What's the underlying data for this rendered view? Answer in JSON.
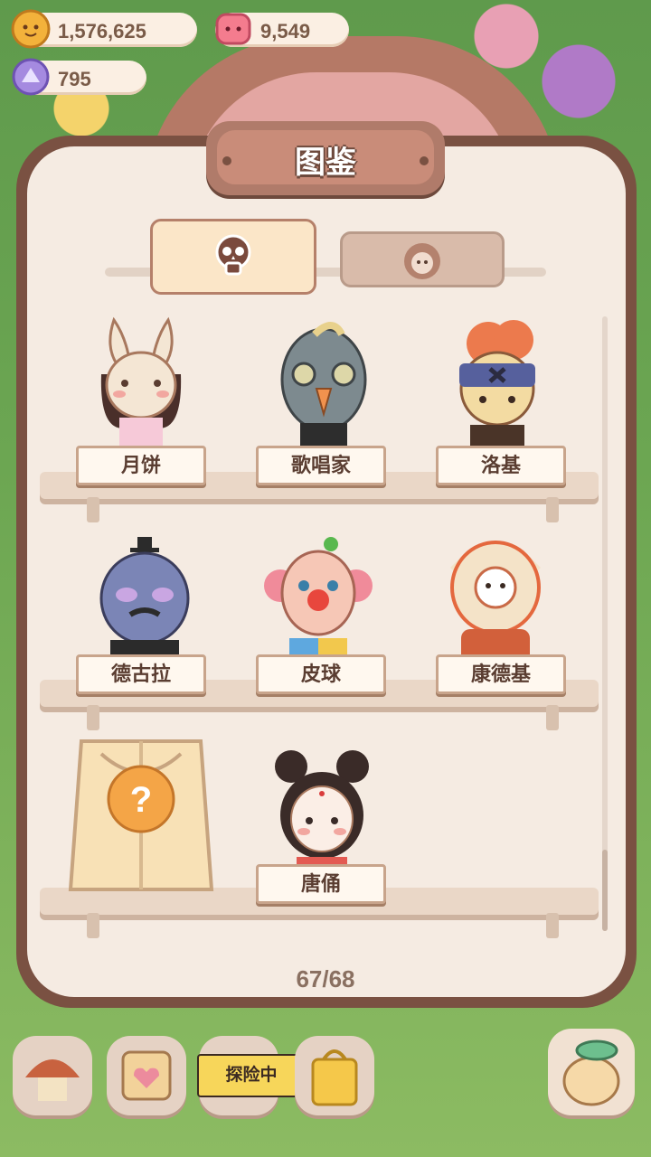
{
  "currencies": {
    "coins": "1,576,625",
    "gems": "9,549",
    "crystals": "795"
  },
  "panel": {
    "title": "图鉴",
    "counter": "67/68"
  },
  "tabs": [
    {
      "icon": "skull-icon",
      "active": true
    },
    {
      "icon": "character-face-icon",
      "active": false
    }
  ],
  "collection": [
    {
      "name": "月饼",
      "icon": "bunny-character-icon"
    },
    {
      "name": "歌唱家",
      "icon": "bird-character-icon"
    },
    {
      "name": "洛基",
      "icon": "pirate-character-icon"
    },
    {
      "name": "德古拉",
      "icon": "dracula-character-icon"
    },
    {
      "name": "皮球",
      "icon": "clown-character-icon"
    },
    {
      "name": "康德基",
      "icon": "chicken-character-icon"
    },
    {
      "name": "",
      "icon": "mystery-package-icon"
    },
    {
      "name": "唐俑",
      "icon": "tang-figurine-character-icon"
    }
  ],
  "bottom_bar": {
    "explore_label": "探险中"
  },
  "colors": {
    "panel_bg": "#f5ebe2",
    "frame": "#7a5142",
    "label_border": "#c8a48b"
  }
}
